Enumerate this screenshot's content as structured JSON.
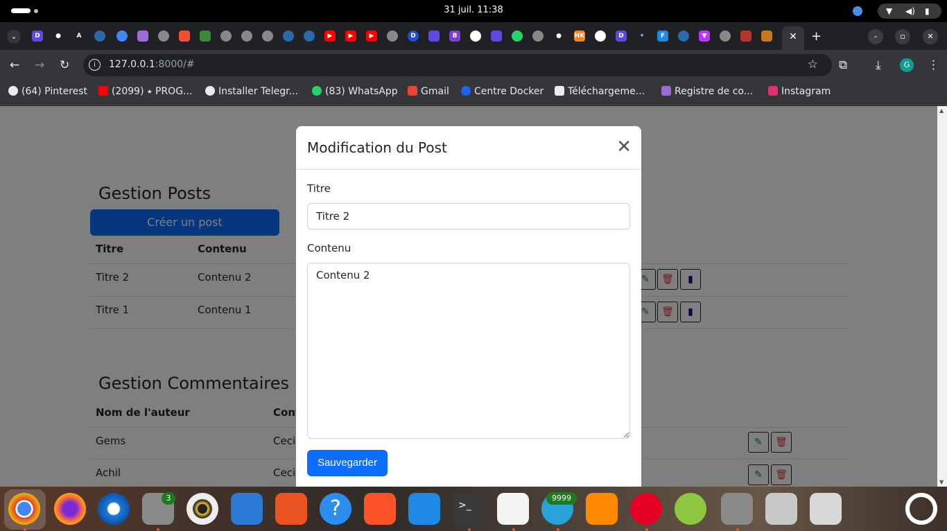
{
  "system": {
    "clock": "31 juil.  11:38"
  },
  "browser": {
    "url_host": "127.0.0.1",
    "url_rest": ":8000/#",
    "avatar_letter": "G",
    "bookmarks": [
      {
        "label": "(64) Pinterest",
        "color": "#e8eaed"
      },
      {
        "label": "(2099) ⭑ PROG...",
        "color": "#ff0000"
      },
      {
        "label": "Installer Telegr...",
        "color": "#e8eaed"
      },
      {
        "label": "(83) WhatsApp",
        "color": "#25d366"
      },
      {
        "label": "Gmail",
        "color": "#ea4335"
      },
      {
        "label": "Centre Docker",
        "color": "#1d63ed"
      },
      {
        "label": "Téléchargeme...",
        "color": "#e8eaed"
      },
      {
        "label": "Registre de co...",
        "color": "#9b6bd6"
      },
      {
        "label": "Instagram",
        "color": "#e1306c"
      }
    ]
  },
  "page": {
    "posts_title": "Gestion Posts",
    "create_label": "Créer un post",
    "posts_headers": [
      "Titre",
      "Contenu"
    ],
    "posts_rows": [
      {
        "title": "Titre 2",
        "content": "Contenu 2"
      },
      {
        "title": "Titre 1",
        "content": "Contenu 1"
      }
    ],
    "comments_title": "Gestion Commentaires",
    "comments_headers": [
      "Nom de l'auteur",
      "Cont"
    ],
    "comments_rows": [
      {
        "author": "Gems",
        "content": "Ceci"
      },
      {
        "author": "Achil",
        "content": "Ceci"
      }
    ]
  },
  "modal": {
    "title": "Modification du Post",
    "title_label": "Titre",
    "title_value": "Titre 2",
    "content_label": "Contenu",
    "content_value": "Contenu 2",
    "save_label": "Sauvegarder"
  },
  "dock": {
    "files_badge": "3",
    "telegram_badge": "9999"
  }
}
